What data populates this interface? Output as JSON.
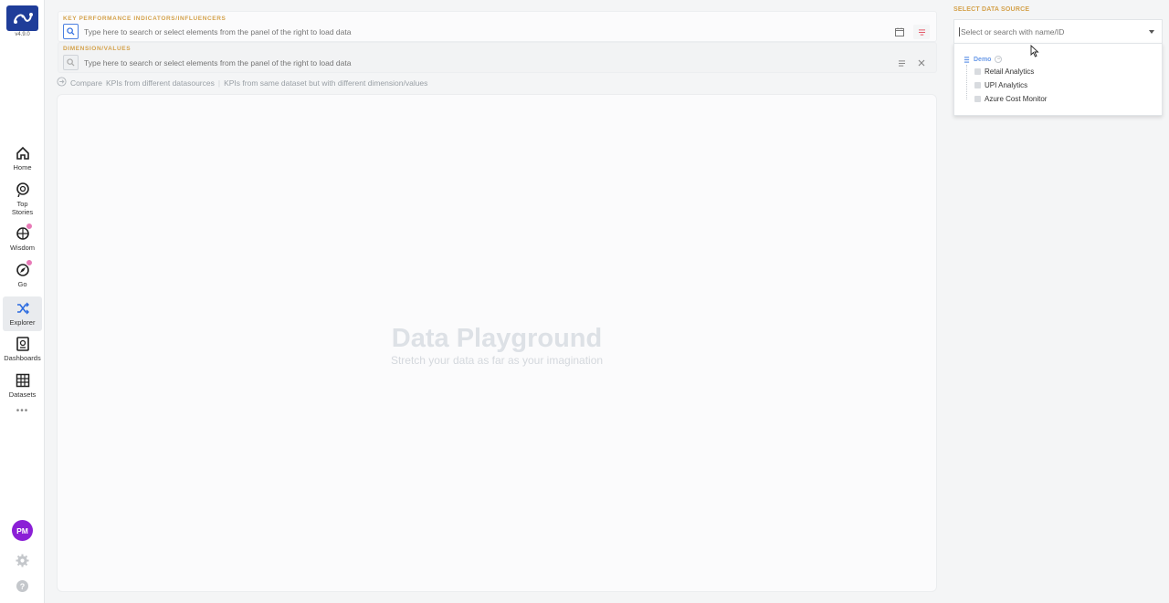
{
  "sidebar": {
    "version": "v4.9.0",
    "items": [
      {
        "label": "Home",
        "icon": "home-icon"
      },
      {
        "label": "Top\nStories",
        "icon": "top-stories-icon"
      },
      {
        "label": "Wisdom",
        "icon": "wisdom-icon"
      },
      {
        "label": "Go",
        "icon": "go-icon"
      },
      {
        "label": "Explorer",
        "icon": "explorer-icon"
      },
      {
        "label": "Dashboards",
        "icon": "dashboards-icon"
      },
      {
        "label": "Datasets",
        "icon": "datasets-icon"
      }
    ],
    "more": "•••",
    "avatar_initials": "PM",
    "help": "?"
  },
  "kpi": {
    "label": "KEY PERFORMANCE INDICATORS/INFLUENCERS",
    "placeholder": "Type here to search or select elements from the panel of the right to load data"
  },
  "dimension": {
    "label": "DIMENSION/VALUES",
    "placeholder": "Type here to search or select elements from the panel of the right to load data"
  },
  "compare": {
    "label": "Compare",
    "option1": "KPIs from different datasources",
    "separator": "|",
    "option2": "KPIs from same dataset but with different dimension/values"
  },
  "playground": {
    "title": "Data Playground",
    "subtitle": "Stretch your data as far as your imagination"
  },
  "datasource": {
    "label": "SELECT DATA SOURCE",
    "placeholder": "Select or search with name/ID",
    "group": "Demo",
    "options": [
      "Retail Analytics",
      "UPI Analytics",
      "Azure Cost Monitor"
    ]
  },
  "colors": {
    "brand": "#1f3d99",
    "section_label": "#d4a24c",
    "avatar": "#8b1fd6",
    "badge": "#e87ab7",
    "tree_root": "#6a9ae8"
  }
}
